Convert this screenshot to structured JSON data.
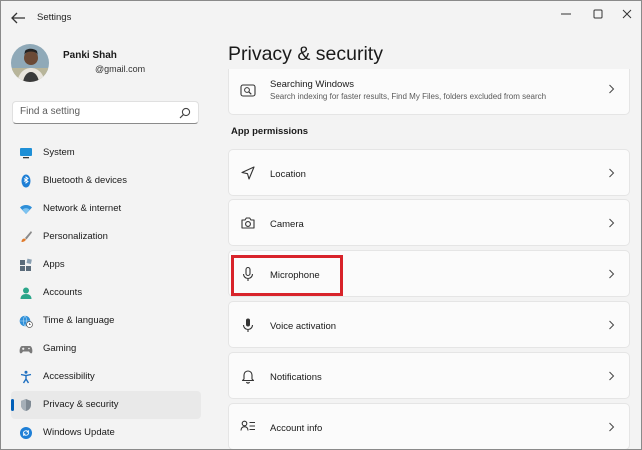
{
  "window": {
    "title": "Settings"
  },
  "user": {
    "name": "Panki Shah",
    "email": "@gmail.com"
  },
  "search": {
    "placeholder": "Find a setting"
  },
  "sidebar": {
    "items": [
      {
        "label": "System",
        "icon": "monitor-icon"
      },
      {
        "label": "Bluetooth & devices",
        "icon": "bluetooth-icon"
      },
      {
        "label": "Network & internet",
        "icon": "wifi-icon"
      },
      {
        "label": "Personalization",
        "icon": "brush-icon"
      },
      {
        "label": "Apps",
        "icon": "apps-icon"
      },
      {
        "label": "Accounts",
        "icon": "person-icon"
      },
      {
        "label": "Time & language",
        "icon": "globe-clock-icon"
      },
      {
        "label": "Gaming",
        "icon": "gamepad-icon"
      },
      {
        "label": "Accessibility",
        "icon": "accessibility-icon"
      },
      {
        "label": "Privacy & security",
        "icon": "shield-icon",
        "selected": true
      },
      {
        "label": "Windows Update",
        "icon": "update-icon"
      }
    ]
  },
  "main": {
    "title": "Privacy & security",
    "searching_windows": {
      "title": "Searching Windows",
      "description": "Search indexing for faster results, Find My Files, folders excluded from search"
    },
    "section_title": "App permissions",
    "permissions": [
      {
        "label": "Location",
        "icon": "location-icon"
      },
      {
        "label": "Camera",
        "icon": "camera-icon"
      },
      {
        "label": "Microphone",
        "icon": "microphone-icon",
        "highlighted": true
      },
      {
        "label": "Voice activation",
        "icon": "microphone-icon"
      },
      {
        "label": "Notifications",
        "icon": "bell-icon"
      },
      {
        "label": "Account info",
        "icon": "account-info-icon"
      }
    ]
  },
  "colors": {
    "accent": "#005fb8",
    "highlight": "#d8232a",
    "background": "#f3f3f3",
    "card": "#fbfbfb"
  }
}
